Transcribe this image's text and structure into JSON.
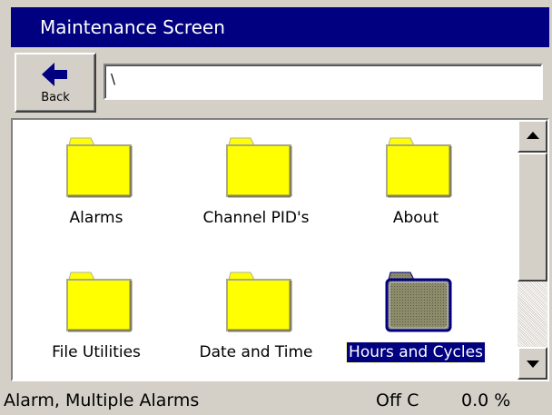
{
  "window": {
    "title": "Maintenance Screen"
  },
  "toolbar": {
    "back_label": "Back",
    "back_icon": "left-arrow-icon",
    "path_value": "\\"
  },
  "folders": [
    {
      "label": "Alarms",
      "icon": "folder-icon",
      "selected": false
    },
    {
      "label": "Channel PID's",
      "icon": "folder-icon",
      "selected": false
    },
    {
      "label": "About",
      "icon": "folder-icon",
      "selected": false
    },
    {
      "label": "File Utilities",
      "icon": "folder-icon",
      "selected": false
    },
    {
      "label": "Date and Time",
      "icon": "folder-icon",
      "selected": false
    },
    {
      "label": "Hours and Cycles",
      "icon": "folder-icon",
      "selected": true
    }
  ],
  "scrollbar": {
    "up_icon": "scroll-up-arrow-icon",
    "down_icon": "scroll-down-arrow-icon"
  },
  "status": {
    "message": "Alarm, Multiple Alarms",
    "temperature": "Off C",
    "percent": "0.0 %"
  },
  "colors": {
    "title_bar": "#000080",
    "folder_fill": "#ffff00",
    "folder_selected_fill": "#7a7a5a",
    "selection_highlight": "#000080",
    "window_face": "#d4d0c8"
  }
}
